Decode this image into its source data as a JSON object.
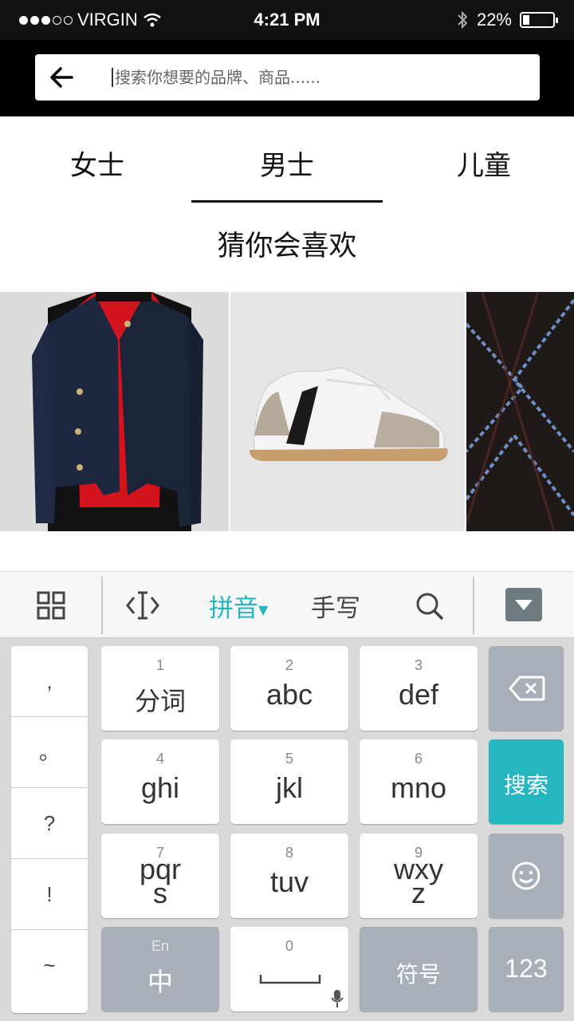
{
  "status_bar": {
    "carrier": "VIRGIN",
    "time": "4:21 PM",
    "battery": "22%",
    "battery_level": 0.22
  },
  "search": {
    "placeholder": "搜索你想要的品牌、商品......"
  },
  "tabs": [
    {
      "label": "女士",
      "selected": false
    },
    {
      "label": "男士",
      "selected": true
    },
    {
      "label": "儿童",
      "selected": false
    }
  ],
  "section_title": "猜你会喜欢",
  "keyboard": {
    "toolbar": {
      "pinyin": "拼音",
      "handwrite": "手写"
    },
    "punctuation": [
      ",",
      "。",
      "?",
      "!",
      "~"
    ],
    "keys": {
      "k1": {
        "num": "1",
        "label": "分词"
      },
      "k2": {
        "num": "2",
        "label": "abc"
      },
      "k3": {
        "num": "3",
        "label": "def"
      },
      "k4": {
        "num": "4",
        "label": "ghi"
      },
      "k5": {
        "num": "5",
        "label": "jkl"
      },
      "k6": {
        "num": "6",
        "label": "mno"
      },
      "k7": {
        "num": "7",
        "label": "pqr",
        "label2": "s"
      },
      "k8": {
        "num": "8",
        "label": "tuv"
      },
      "k9": {
        "num": "9",
        "label": "wxy",
        "label2": "z"
      },
      "k0": {
        "num": "0"
      },
      "lang": {
        "small": "En",
        "label": "中"
      },
      "symbols": "符号",
      "numbers": "123",
      "search": "搜索"
    },
    "colors": {
      "accent": "#26b6c0",
      "function_key": "#a7b0b8"
    }
  }
}
